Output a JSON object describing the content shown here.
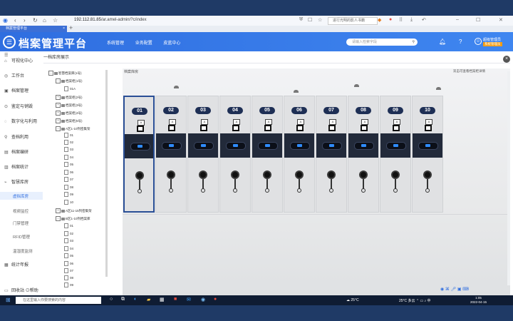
{
  "browser": {
    "tab_title": "档案管理平台",
    "url_host": "192.112.81.85",
    "url_path": "/ar.amel-admin/?c/index",
    "right_search": "进行光明的影人书籍"
  },
  "app": {
    "title": "档案管理平台",
    "menu": [
      "系统管理",
      "业务配置",
      "皮蓝中心"
    ],
    "search_placeholder": "请输入检索字段",
    "user_name": "超级管理员",
    "user_role": "系统管理员"
  },
  "sidebar": {
    "items": [
      {
        "label": "可视化中心",
        "icon": "home-icon"
      },
      {
        "label": "工作台",
        "icon": "desk-icon"
      },
      {
        "label": "档案管理",
        "icon": "folder-icon"
      },
      {
        "label": "鉴定与销毁",
        "icon": "check-icon"
      },
      {
        "label": "数字化与利用",
        "icon": "digital-icon"
      },
      {
        "label": "查档利用",
        "icon": "search-icon"
      },
      {
        "label": "档案编研",
        "icon": "book-icon"
      },
      {
        "label": "档案统计",
        "icon": "chart-icon"
      },
      {
        "label": "智慧库房",
        "icon": "warehouse-icon"
      }
    ],
    "subitems": [
      "虚拟库房",
      "视频监控",
      "门禁管理",
      "RFID管理",
      "温湿度监测"
    ],
    "active_sub": "虚拟库房",
    "last_item": "统计年报",
    "bottom_left": "回收站",
    "bottom_right": "帮助"
  },
  "page": {
    "header": "一档库房展示",
    "scene_title": "档案库房",
    "scene_right": "双击可查看档案柜详情"
  },
  "tree": {
    "root": "智慧档案库(1号)",
    "nodes": [
      "档案柜(1号)",
      "01A",
      "档案柜(2号)",
      "档案柜(3号)",
      "档案柜(4号)",
      "档案柜(5号)",
      "A区1-10列密集架"
    ],
    "rows_a": [
      "01",
      "02",
      "03",
      "04",
      "05",
      "06",
      "07",
      "08",
      "09",
      "10"
    ],
    "node_b": "A区11-15列密集架",
    "node_c": "B区1-10列档案库",
    "rows_c": [
      "01",
      "02",
      "03",
      "04",
      "05",
      "06",
      "07",
      "08",
      "09"
    ]
  },
  "cabinets": [
    "01",
    "02",
    "03",
    "04",
    "05",
    "06",
    "07",
    "08",
    "09",
    "10"
  ],
  "taskbar": {
    "search_placeholder": "在这里输入你要搜索的内容",
    "weather": "25°C",
    "tray_weather": "25°C 多云",
    "time": "1:05",
    "date": "2022-04-15"
  }
}
